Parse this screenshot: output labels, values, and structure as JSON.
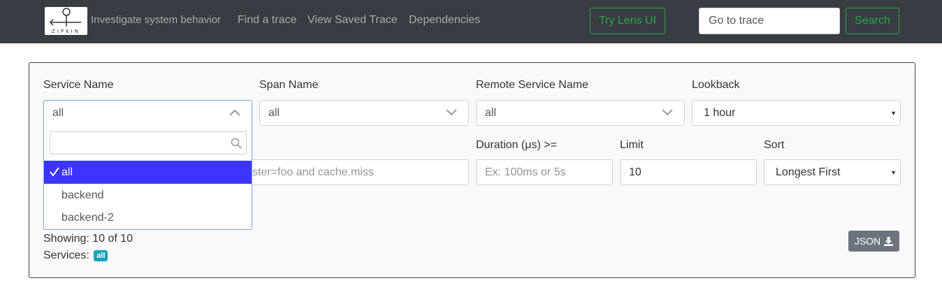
{
  "nav": {
    "logo_text": "ZIPKIN",
    "tagline": "Investigate system behavior",
    "links": [
      "Find a trace",
      "View Saved Trace",
      "Dependencies"
    ],
    "lens_button": "Try Lens UI",
    "goto_placeholder": "Go to trace",
    "search_button": "Search"
  },
  "form": {
    "service_name": {
      "label": "Service Name",
      "value": "all"
    },
    "span_name": {
      "label": "Span Name",
      "value": "all"
    },
    "remote_service_name": {
      "label": "Remote Service Name",
      "value": "all"
    },
    "lookback": {
      "label": "Lookback",
      "value": "1 hour"
    },
    "annotation_query": {
      "placeholder_visible": "ster=foo and cache.miss"
    },
    "duration": {
      "label": "Duration (μs) >=",
      "placeholder": "Ex: 100ms or 5s"
    },
    "limit": {
      "label": "Limit",
      "value": "10"
    },
    "sort": {
      "label": "Sort",
      "value": "Longest First"
    }
  },
  "dropdown": {
    "options": [
      {
        "label": "all",
        "selected": true
      },
      {
        "label": "backend",
        "selected": false
      },
      {
        "label": "backend-2",
        "selected": false
      }
    ]
  },
  "results": {
    "showing": "Showing: 10 of 10",
    "services_label": "Services:",
    "services_badge": "all",
    "json_button": "JSON"
  },
  "colors": {
    "navbar": "#383d43",
    "accent_green": "#28a745",
    "selected_option": "#3b35ff",
    "badge": "#17a2b8"
  },
  "icons": [
    "zipkin-logo",
    "chevron-up-icon",
    "chevron-down-icon",
    "caret-down-icon",
    "search-icon",
    "check-icon",
    "download-icon"
  ]
}
